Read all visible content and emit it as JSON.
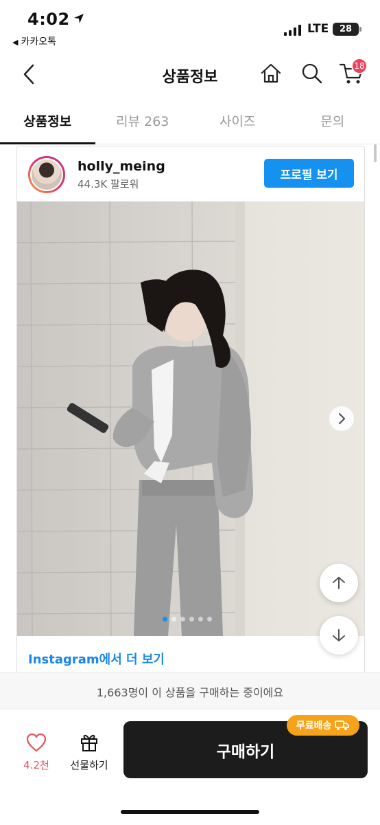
{
  "status_bar": {
    "time": "4:02",
    "back_app": "카카오톡",
    "network": "LTE",
    "battery": "28"
  },
  "header": {
    "title": "상품정보",
    "cart_count": "18",
    "icons": [
      "back-icon",
      "home-icon",
      "search-icon",
      "cart-icon"
    ]
  },
  "tabs": [
    {
      "label": "상품정보",
      "active": true
    },
    {
      "label": "리뷰 263",
      "active": false
    },
    {
      "label": "사이즈",
      "active": false
    },
    {
      "label": "문의",
      "active": false
    }
  ],
  "instagram": {
    "username": "holly_meing",
    "followers": "44.3K 팔로워",
    "profile_button": "프로필 보기",
    "more_link": "Instagram에서 더 보기",
    "carousel_count": 6,
    "carousel_index": 1
  },
  "buyers_notice": "1,663명이 이 상품을 구매하는 중이에요",
  "bottom": {
    "like_count": "4.2천",
    "gift_label": "선물하기",
    "buy_label": "구매하기",
    "free_shipping_label": "무료배송"
  },
  "colors": {
    "accent_blue": "#1592f0",
    "badge_red": "#f0415c",
    "like_red": "#e8505b",
    "free_shipping_orange": "#f7a21b",
    "buy_button": "#1c1c1c"
  }
}
